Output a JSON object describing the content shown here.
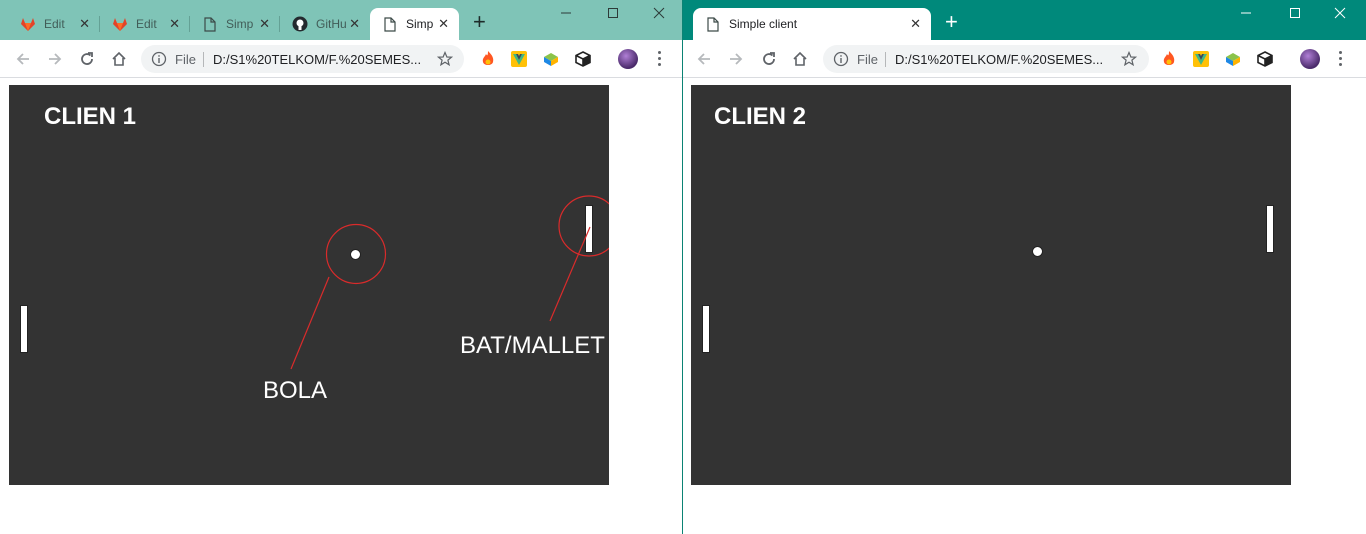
{
  "left_window": {
    "tabs": [
      {
        "title": "Edit",
        "icon": "gitlab-icon"
      },
      {
        "title": "Edit",
        "icon": "gitlab-icon"
      },
      {
        "title": "Simp",
        "icon": "page-icon"
      },
      {
        "title": "GitHu",
        "icon": "github-icon"
      },
      {
        "title": "Simp",
        "icon": "page-icon",
        "active": true
      }
    ],
    "omnibox": {
      "scheme": "File",
      "url": "D:/S1%20TELKOM/F.%20SEMES..."
    },
    "game": {
      "label": "CLIEN 1",
      "annotations": {
        "ball": "BOLA",
        "bat": "BAT/MALLET"
      }
    }
  },
  "right_window": {
    "tabs": [
      {
        "title": "Simple client",
        "icon": "page-icon",
        "active": true
      }
    ],
    "omnibox": {
      "scheme": "File",
      "url": "D:/S1%20TELKOM/F.%20SEMES..."
    },
    "game": {
      "label": "CLIEN 2"
    }
  },
  "colors": {
    "left_frame": "#7fc4b7",
    "right_frame": "#00897b",
    "game_bg": "#333333",
    "annotation": "#d92b2b"
  }
}
